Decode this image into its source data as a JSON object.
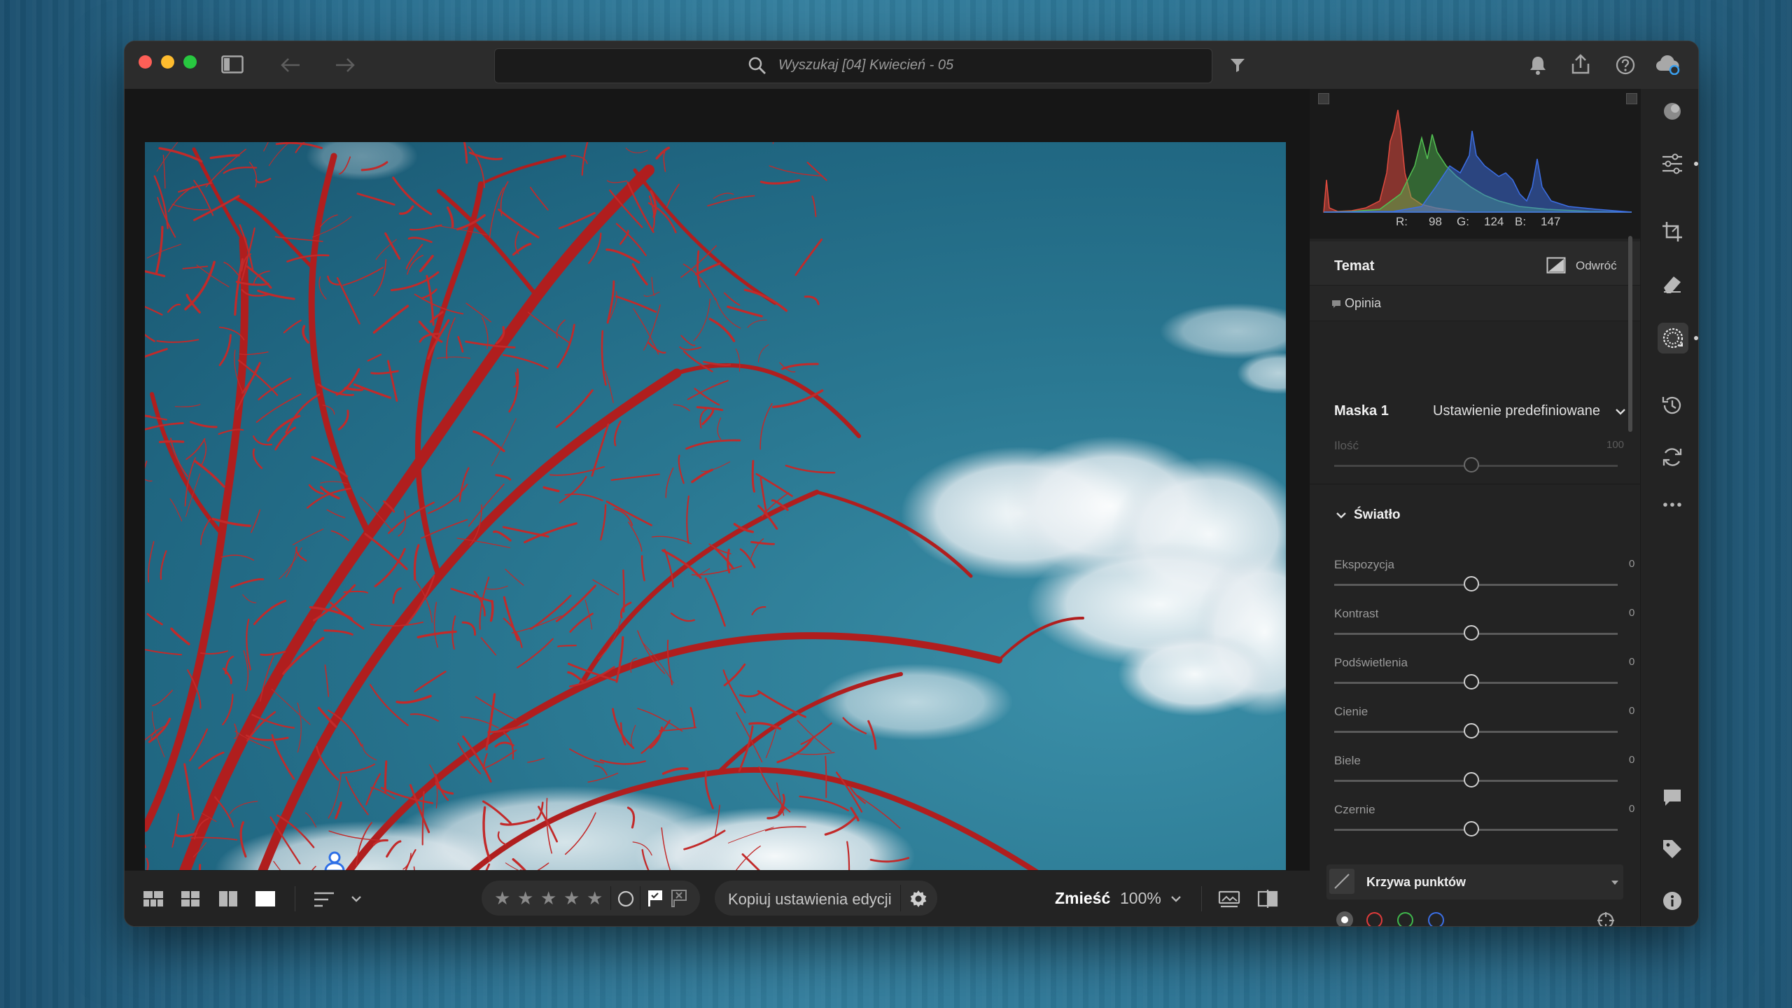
{
  "window": {
    "search": {
      "placeholder": "Wyszukaj [04] Kwiecień - 05"
    }
  },
  "bottombar": {
    "copy_settings": "Kopiuj ustawienia edycji",
    "zoom_fit": "Zmieść",
    "zoom_level": "100%"
  },
  "panel": {
    "histogram": {
      "r_label": "R:",
      "r": "98",
      "g_label": "G:",
      "g": "124",
      "b_label": "B:",
      "b": "147"
    },
    "subject": {
      "title": "Temat",
      "invert": "Odwróć"
    },
    "feedback": "Opinia",
    "mask": {
      "name": "Maska 1",
      "preset": "Ustawienie predefiniowane",
      "amount_label": "Ilość",
      "amount_value": "100"
    },
    "light": {
      "title": "Światło",
      "sliders": [
        {
          "label": "Ekspozycja",
          "value": "0"
        },
        {
          "label": "Kontrast",
          "value": "0"
        },
        {
          "label": "Podświetlenia",
          "value": "0"
        },
        {
          "label": "Cienie",
          "value": "0"
        },
        {
          "label": "Biele",
          "value": "0"
        },
        {
          "label": "Czernie",
          "value": "0"
        }
      ]
    },
    "point_curve": {
      "title": "Krzywa punktów"
    }
  },
  "colors": {
    "mask_overlay": "#b01e1e",
    "histogram_red": "#e04b3f",
    "histogram_green": "#52c152",
    "histogram_blue": "#3c6fe6"
  }
}
